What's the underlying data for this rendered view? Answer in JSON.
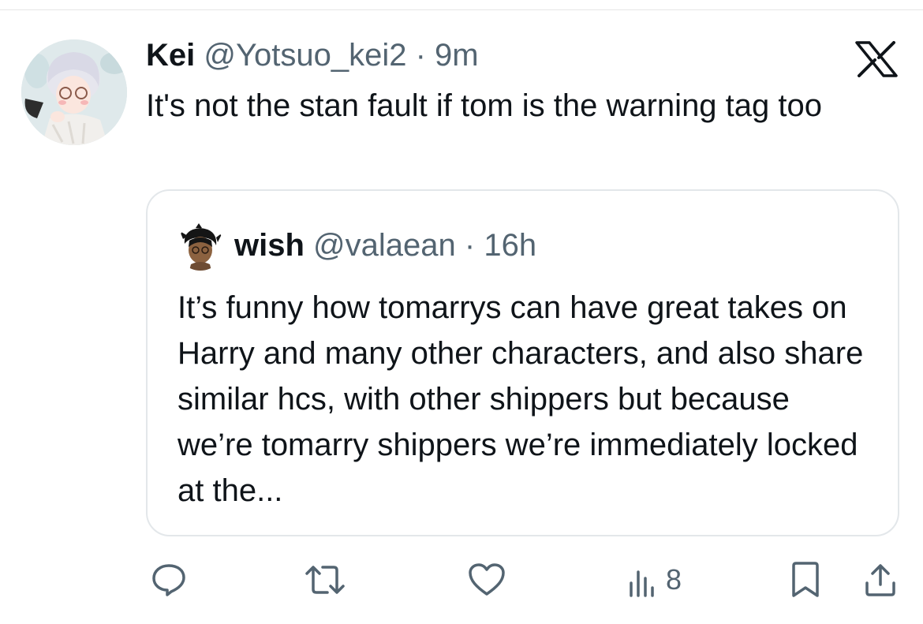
{
  "tweet": {
    "author_name": "Kei",
    "author_handle": "@Yotsuo_kei2",
    "separator": "·",
    "time": "9m",
    "text": "It's not the stan fault if tom is the warning tag too"
  },
  "quoted_tweet": {
    "author_name": "wish",
    "author_handle": "@valaean",
    "separator": "·",
    "time": "16h",
    "text": "It’s funny how tomarrys can have great takes on Harry and many other characters, and also share similar hcs, with other shippers but because we’re tomarry shippers we’re immediately locked at the..."
  },
  "actions": {
    "views_count": "8",
    "icons": [
      "reply-icon",
      "repost-icon",
      "like-icon",
      "views-icon",
      "bookmark-icon",
      "share-icon"
    ],
    "icon_color": "#536471"
  },
  "brand": {
    "logo": "x-logo",
    "text_color": "#0f1419",
    "muted_color": "#536471",
    "border_color": "#e3e7ea"
  }
}
